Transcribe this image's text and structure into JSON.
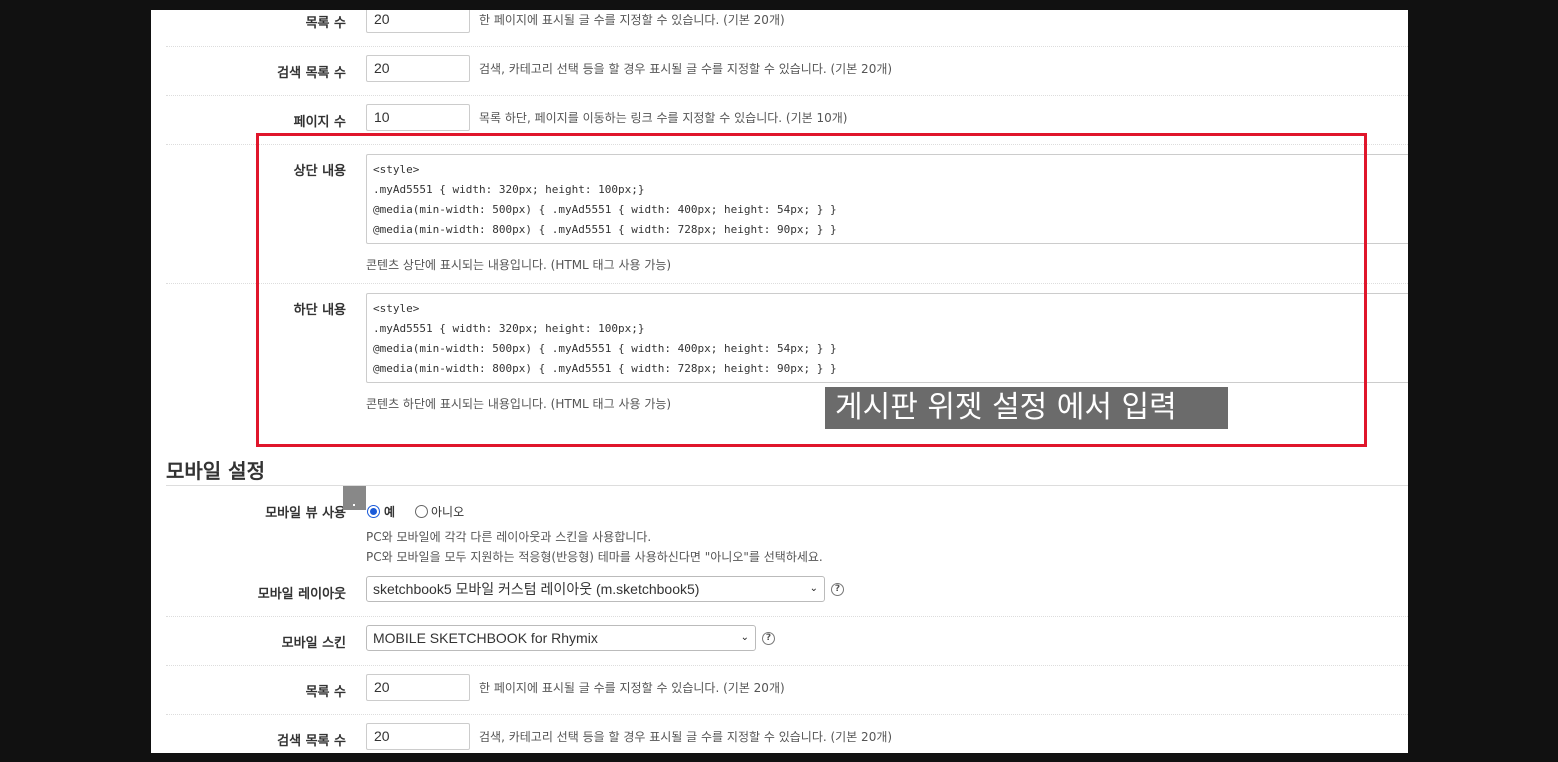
{
  "list_count": {
    "label": "목록 수",
    "value": "20",
    "help": "한 페이지에 표시될 글 수를 지정할 수 있습니다. (기본 20개)"
  },
  "search_list_count": {
    "label": "검색 목록 수",
    "value": "20",
    "help": "검색, 카테고리 선택 등을 할 경우 표시될 글 수를 지정할 수 있습니다. (기본 20개)"
  },
  "page_count": {
    "label": "페이지 수",
    "value": "10",
    "help": "목록 하단, 페이지를 이동하는 링크 수를 지정할 수 있습니다. (기본 10개)"
  },
  "header_content": {
    "label": "상단 내용",
    "lines": [
      "<style>",
      ".myAd5551 { width: 320px; height: 100px;}",
      "@media(min-width: 500px) { .myAd5551 { width: 400px; height: 54px; } }",
      "@media(min-width: 800px) { .myAd5551 { width: 728px; height: 90px; } }"
    ],
    "desc": "콘텐츠 상단에 표시되는 내용입니다. (HTML 태그 사용 가능)"
  },
  "footer_content": {
    "label": "하단 내용",
    "lines": [
      "<style>",
      ".myAd5551 { width: 320px; height: 100px;}",
      "@media(min-width: 500px) { .myAd5551 { width: 400px; height: 54px; } }",
      "@media(min-width: 800px) { .myAd5551 { width: 728px; height: 90px; } }"
    ],
    "desc": "콘텐츠 하단에 표시되는 내용입니다. (HTML 태그 사용 가능)"
  },
  "overlay_caption": "게시판 위젯 설정 에서 입력",
  "mobile_section_title": "모바일 설정",
  "mobile_view": {
    "label": "모바일 뷰 사용",
    "option_yes": "예",
    "option_no": "아니오",
    "selected": "예",
    "desc1": "PC와 모바일에 각각 다른 레이아웃과 스킨을 사용합니다.",
    "desc2": "PC와 모바일을 모두 지원하는 적응형(반응형) 테마를 사용하신다면 \"아니오\"를 선택하세요."
  },
  "mobile_layout": {
    "label": "모바일 레이아웃",
    "value": "sketchbook5 모바일 커스텀 레이아웃 (m.sketchbook5)"
  },
  "mobile_skin": {
    "label": "모바일 스킨",
    "value": "MOBILE SKETCHBOOK for Rhymix"
  },
  "mobile_list_count": {
    "label": "목록 수",
    "value": "20",
    "help": "한 페이지에 표시될 글 수를 지정할 수 있습니다. (기본 20개)"
  },
  "mobile_search_list_count": {
    "label": "검색 목록 수",
    "value": "20",
    "help": "검색, 카테고리 선택 등을 할 경우 표시될 글 수를 지정할 수 있습니다. (기본 20개)"
  },
  "icons": {
    "help": "question-circle-icon",
    "dropdown": "chevron-down-icon"
  },
  "colors": {
    "highlight_border": "#e0162b",
    "overlay_bg": "#6b6b6b",
    "radio_accent": "#1a5ad8"
  }
}
